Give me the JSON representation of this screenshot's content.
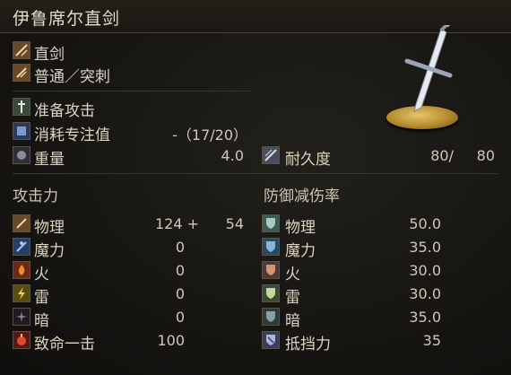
{
  "title": "伊鲁席尔直剑",
  "info": {
    "weapon_type": "直剑",
    "attack_type": "普通／突刺",
    "skill": "准备攻击",
    "fp_label": "消耗专注值",
    "fp_value": "-（17/20）",
    "weight_label": "重量",
    "weight_value": "4.0",
    "durability_label": "耐久度",
    "durability_current": "80/",
    "durability_max": "80"
  },
  "attack": {
    "header": "攻击力",
    "rows": [
      {
        "label": "物理",
        "value": "124 +",
        "bonus": "54",
        "icon": "sword-physical-icon"
      },
      {
        "label": "魔力",
        "value": "0",
        "bonus": "",
        "icon": "magic-icon"
      },
      {
        "label": "火",
        "value": "0",
        "bonus": "",
        "icon": "fire-icon"
      },
      {
        "label": "雷",
        "value": "0",
        "bonus": "",
        "icon": "lightning-icon"
      },
      {
        "label": "暗",
        "value": "0",
        "bonus": "",
        "icon": "dark-icon"
      },
      {
        "label": "致命一击",
        "value": "100",
        "bonus": "",
        "icon": "critical-icon"
      }
    ]
  },
  "defense": {
    "header": "防御减伤率",
    "rows": [
      {
        "label": "物理",
        "value": "50.0",
        "icon": "shield-physical-icon"
      },
      {
        "label": "魔力",
        "value": "35.0",
        "icon": "shield-magic-icon"
      },
      {
        "label": "火",
        "value": "30.0",
        "icon": "shield-fire-icon"
      },
      {
        "label": "雷",
        "value": "30.0",
        "icon": "shield-lightning-icon"
      },
      {
        "label": "暗",
        "value": "35.0",
        "icon": "shield-dark-icon"
      },
      {
        "label": "抵挡力",
        "value": "35",
        "icon": "stability-icon"
      }
    ]
  },
  "colors": {
    "background": "#171512",
    "text": "#dcd4c2",
    "gold": "#c9a24a"
  }
}
